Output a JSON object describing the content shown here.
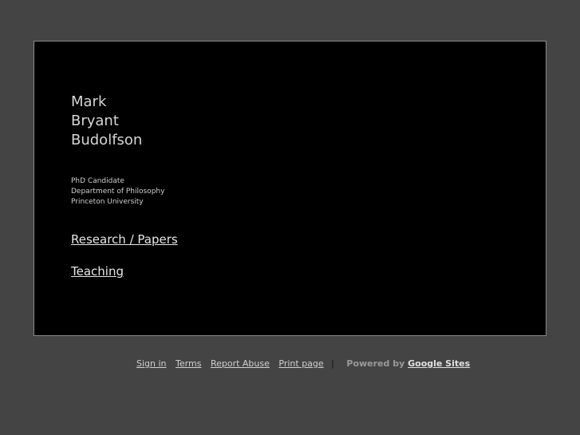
{
  "profile": {
    "name_lines": [
      "Mark",
      "Bryant",
      "Budolfson"
    ],
    "info_lines": [
      "PhD Candidate",
      "Department of Philosophy",
      "Princeton University"
    ]
  },
  "nav": {
    "research": "Research / Papers",
    "teaching": "Teaching"
  },
  "footer": {
    "sign_in": "Sign in",
    "terms": "Terms",
    "report_abuse": "Report Abuse",
    "print_page": "Print page",
    "separator": "|",
    "powered_by": "Powered by",
    "google_sites": "Google Sites"
  }
}
